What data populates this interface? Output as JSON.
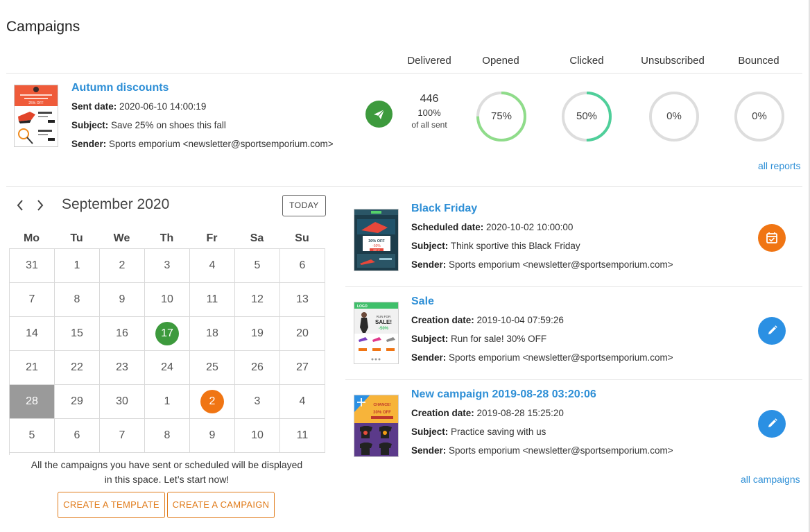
{
  "page": {
    "title": "Campaigns"
  },
  "stats_headers": [
    "Delivered",
    "Opened",
    "Clicked",
    "Unsubscribed",
    "Bounced"
  ],
  "sent_campaign": {
    "name": "Autumn discounts",
    "date_label": "Sent date:",
    "date": "2020-06-10 14:00:19",
    "subject_label": "Subject:",
    "subject": "Save 25% on shoes this fall",
    "sender_label": "Sender:",
    "sender": "Sports emporium <newsletter@sportsemporium.com>",
    "status_icon": "paper-plane-icon",
    "delivered": {
      "count": "446",
      "percent": "100%",
      "note": "of all sent"
    },
    "rings": [
      {
        "key": "opened",
        "label": "75%",
        "value": 0.75,
        "color": "#8fdc8a"
      },
      {
        "key": "clicked",
        "label": "50%",
        "value": 0.5,
        "color": "#4fcf9a"
      },
      {
        "key": "unsubscribed",
        "label": "0%",
        "value": 0,
        "color": "#dddddd"
      },
      {
        "key": "bounced",
        "label": "0%",
        "value": 0,
        "color": "#dddddd"
      }
    ]
  },
  "links": {
    "all_reports": "all reports",
    "all_campaigns": "all campaigns"
  },
  "calendar": {
    "month": "September 2020",
    "today_label": "TODAY",
    "prev_icon": "chevron-left-icon",
    "next_icon": "chevron-right-icon",
    "weekdays": [
      "Mo",
      "Tu",
      "We",
      "Th",
      "Fr",
      "Sa",
      "Su"
    ],
    "weeks": [
      [
        "31",
        "1",
        "2",
        "3",
        "4",
        "5",
        "6"
      ],
      [
        "7",
        "8",
        "9",
        "10",
        "11",
        "12",
        "13"
      ],
      [
        "14",
        "15",
        "16",
        "17",
        "18",
        "19",
        "20"
      ],
      [
        "21",
        "22",
        "23",
        "24",
        "25",
        "26",
        "27"
      ],
      [
        "28",
        "29",
        "30",
        "1",
        "2",
        "3",
        "4"
      ],
      [
        "5",
        "6",
        "7",
        "8",
        "9",
        "10",
        "11"
      ]
    ],
    "highlights": [
      {
        "week": 2,
        "day": 3,
        "type": "sent",
        "color": "#3d9a3d"
      },
      {
        "week": 4,
        "day": 4,
        "type": "scheduled",
        "color": "#f07513"
      },
      {
        "week": 4,
        "day": 0,
        "type": "selected",
        "color": "#9a9a9a"
      }
    ],
    "empty_message_line1": "All the campaigns you have sent or scheduled will be displayed",
    "empty_message_line2": "in this space. Let’s start now!",
    "create_template": "CREATE A TEMPLATE",
    "create_campaign": "CREATE A CAMPAIGN"
  },
  "campaigns": [
    {
      "name": "Black Friday",
      "date_label": "Scheduled date:",
      "date": "2020-10-02 10:00:00",
      "subject_label": "Subject:",
      "subject": "Think sportive this Black Friday",
      "sender_label": "Sender:",
      "sender": "Sports emporium <newsletter@sportsemporium.com>",
      "action_icon": "calendar-check-icon",
      "action_color": "#f07513"
    },
    {
      "name": "Sale",
      "date_label": "Creation date:",
      "date": "2019-10-04 07:59:26",
      "subject_label": "Subject:",
      "subject": "Run for sale! 30% OFF",
      "sender_label": "Sender:",
      "sender": "Sports emporium <newsletter@sportsemporium.com>",
      "action_icon": "pencil-icon",
      "action_color": "#2b90e3"
    },
    {
      "name": "New campaign 2019-08-28 03:20:06",
      "date_label": "Creation date:",
      "date": "2019-08-28 15:25:20",
      "subject_label": "Subject:",
      "subject": "Practice saving with us",
      "sender_label": "Sender:",
      "sender": "Sports emporium <newsletter@sportsemporium.com>",
      "action_icon": "pencil-icon",
      "action_color": "#2b90e3"
    }
  ],
  "thumbnail_text": {
    "autumn_off": "25% OFF",
    "bf_off": "30% OFF",
    "bf_pct": "-50%",
    "bf_get": "GET IT",
    "sale_logo": "LOGO",
    "sale_run": "RUN FOR",
    "sale_sale": "SALE!",
    "sale_pct": "-50%",
    "nc_chance": "CHANCE!",
    "nc_off": "30% OFF"
  }
}
